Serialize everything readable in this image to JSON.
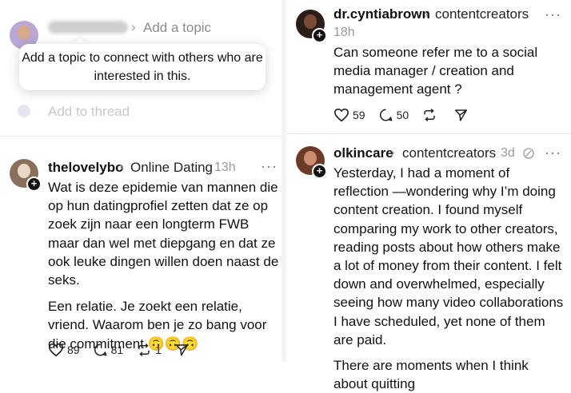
{
  "composer": {
    "add_topic": "Add a topic",
    "tooltip": "Add a topic to connect with others who are interested in this.",
    "add_to_thread": "Add to thread"
  },
  "posts": [
    {
      "username": "thelovelybo",
      "topic": "Online Dating",
      "time": "13h",
      "paragraphs": [
        "Wat is deze epidemie van mannen die op hun datingprofiel zetten dat ze op zoek zijn naar een longterm FWB maar dan wel met diepgang en dat ze ook leuke dingen willen doen naast de seks.",
        "Een relatie. Je zoekt een relatie, vriend. Waarom ben je zo bang voor die commitment 🙃🙃🙃"
      ],
      "likes": "89",
      "replies": "81",
      "reposts": "1"
    },
    {
      "username": "dr.cyntiabrown",
      "topic": "contentcreators",
      "time": "18h",
      "paragraphs": [
        "Can someone refer me to a social media manager / creation and management agent ?"
      ],
      "likes": "59",
      "replies": "50"
    },
    {
      "username": "olkincare",
      "topic": "contentcreators",
      "time": "3d",
      "paragraphs": [
        "Yesterday, I had a moment of reflection —wondering why I’m doing content creation. I found myself comparing my work to other creators, reading posts about how others make a lot of money from their content. I felt down and overwhelmed, especially seeing how many video collaborations I have scheduled, yet none of them are paid.",
        "There are moments when I think about quitting"
      ]
    }
  ],
  "colors": {
    "text": "#101010",
    "muted": "#9a9a9a",
    "faded": "#c8c8c8",
    "divider": "#e6e6e6"
  }
}
